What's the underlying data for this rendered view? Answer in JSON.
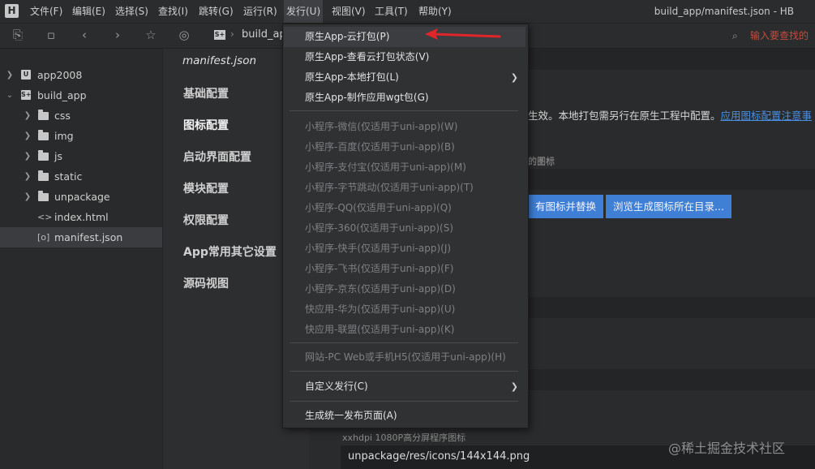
{
  "menubar": {
    "items": [
      "文件(F)",
      "编辑(E)",
      "选择(S)",
      "查找(I)",
      "跳转(G)",
      "运行(R)",
      "发行(U)",
      "视图(V)",
      "工具(T)",
      "帮助(Y)"
    ],
    "window_title": "build_app/manifest.json - HB"
  },
  "toolbar": {
    "breadcrumb_project": "build_app",
    "search_placeholder": "输入要查找的"
  },
  "sidebar": {
    "items": [
      {
        "label": "app2008",
        "type": "project",
        "expanded": false
      },
      {
        "label": "build_app",
        "type": "project",
        "expanded": true
      },
      {
        "label": "css",
        "type": "folder"
      },
      {
        "label": "img",
        "type": "folder"
      },
      {
        "label": "js",
        "type": "folder"
      },
      {
        "label": "static",
        "type": "folder"
      },
      {
        "label": "unpackage",
        "type": "folder"
      },
      {
        "label": "index.html",
        "type": "html-file"
      },
      {
        "label": "manifest.json",
        "type": "json-file",
        "selected": true
      }
    ]
  },
  "config_nav": {
    "title": "manifest.json",
    "items": [
      "基础配置",
      "图标配置",
      "启动界面配置",
      "模块配置",
      "权限配置",
      "App常用其它设置",
      "源码视图"
    ]
  },
  "main": {
    "notice_tail": "生效。本地打包需另行在原生工程中配置。",
    "notice_link": "应用图标配置注意事",
    "faint_label": "的图标",
    "button_replace": "有图标并替换",
    "button_browse": "浏览生成图标所在目录...",
    "icon_caption": "xxhdpi 1080P高分屏程序图标",
    "icon_path": "unpackage/res/icons/144x144.png"
  },
  "watermark": "@稀土掘金技术社区",
  "dropdown": {
    "group1": [
      "原生App-云打包(P)",
      "原生App-查看云打包状态(V)",
      "原生App-本地打包(L)",
      "原生App-制作应用wgt包(G)"
    ],
    "group2": [
      "小程序-微信(仅适用于uni-app)(W)",
      "小程序-百度(仅适用于uni-app)(B)",
      "小程序-支付宝(仅适用于uni-app)(M)",
      "小程序-字节跳动(仅适用于uni-app)(T)",
      "小程序-QQ(仅适用于uni-app)(Q)",
      "小程序-360(仅适用于uni-app)(S)",
      "小程序-快手(仅适用于uni-app)(J)",
      "小程序-飞书(仅适用于uni-app)(F)",
      "小程序-京东(仅适用于uni-app)(D)",
      "快应用-华为(仅适用于uni-app)(U)",
      "快应用-联盟(仅适用于uni-app)(K)"
    ],
    "group3": [
      "网站-PC Web或手机H5(仅适用于uni-app)(H)"
    ],
    "group4": [
      "自定义发行(C)"
    ],
    "group5": [
      "生成统一发布页面(A)"
    ]
  },
  "colors": {
    "accent_button": "#3f7fd6",
    "link": "#4a8fe0",
    "annotation_arrow": "#e0262b"
  }
}
